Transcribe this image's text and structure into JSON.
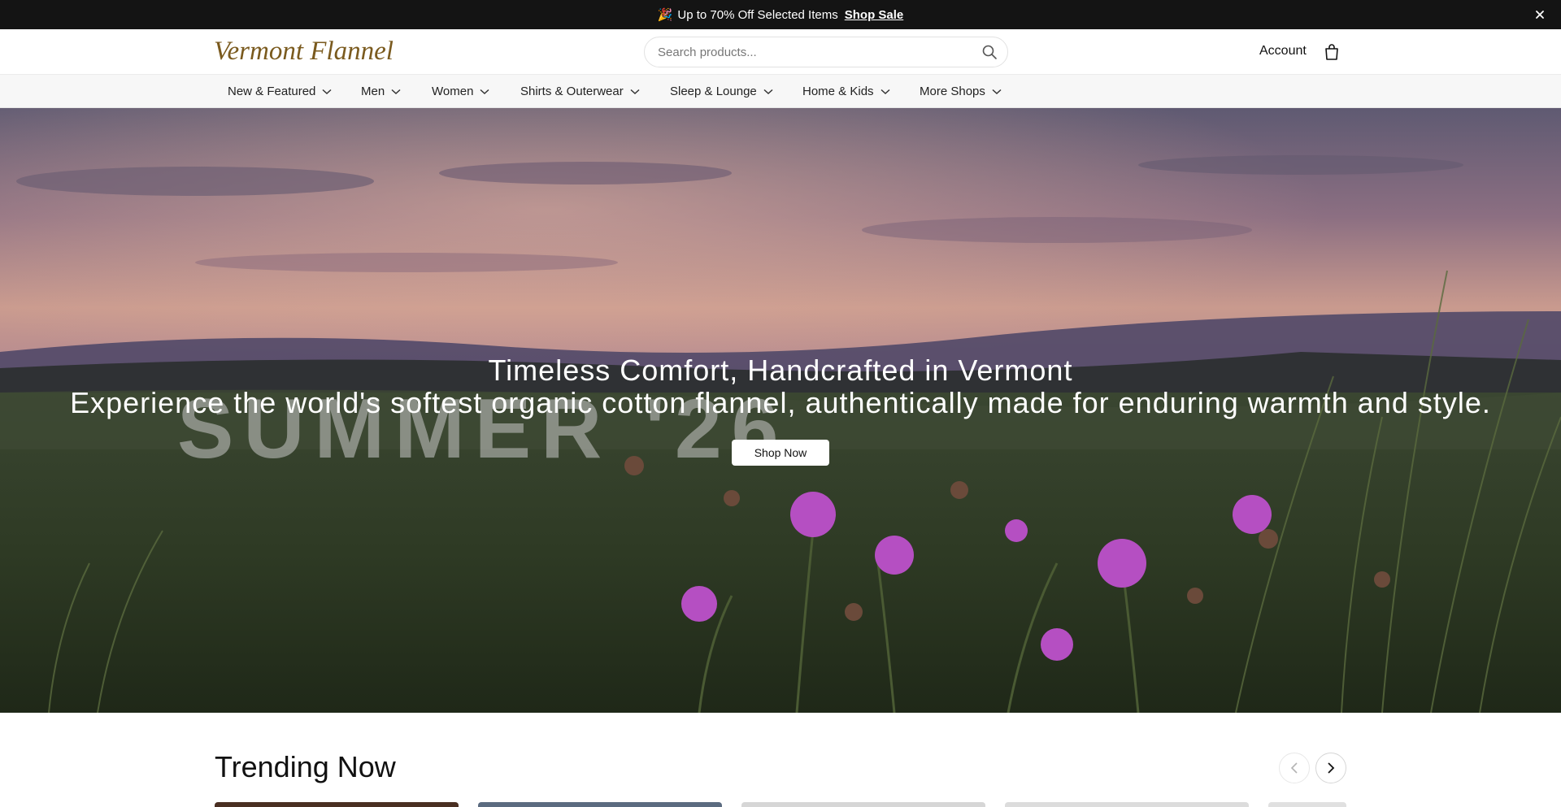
{
  "announcement": {
    "message": "Up to 70% Off Selected Items",
    "link": "Shop Sale",
    "party_icon": "party-popper-icon",
    "close_icon": "close-icon"
  },
  "header": {
    "logo_text": "Vermont Flannel",
    "search": {
      "placeholder": "Search products...",
      "value": ""
    },
    "account": "Account",
    "icons": [
      "search-icon",
      "shopping-bag-icon"
    ]
  },
  "nav": {
    "items": [
      {
        "label": "New & Featured"
      },
      {
        "label": "Men"
      },
      {
        "label": "Women"
      },
      {
        "label": "Shirts & Outerwear"
      },
      {
        "label": "Sleep & Lounge"
      },
      {
        "label": "Home & Kids"
      },
      {
        "label": "More Shops"
      }
    ]
  },
  "hero": {
    "title": "Timeless Comfort, Handcrafted in Vermont",
    "subtitle": "Experience the world's softest organic cotton flannel, authentically made for enduring warmth and style.",
    "watermark": "SUMMER '26",
    "button": "Shop Now"
  },
  "trending": {
    "title": "Trending Now",
    "prev_icon": "chevron-left-icon",
    "next_icon": "chevron-right-icon"
  },
  "colors": {
    "announcement_bg": "#141414",
    "nav_bg": "#f7f7f7",
    "logo": "#7a5a1e",
    "text": "#111111"
  }
}
